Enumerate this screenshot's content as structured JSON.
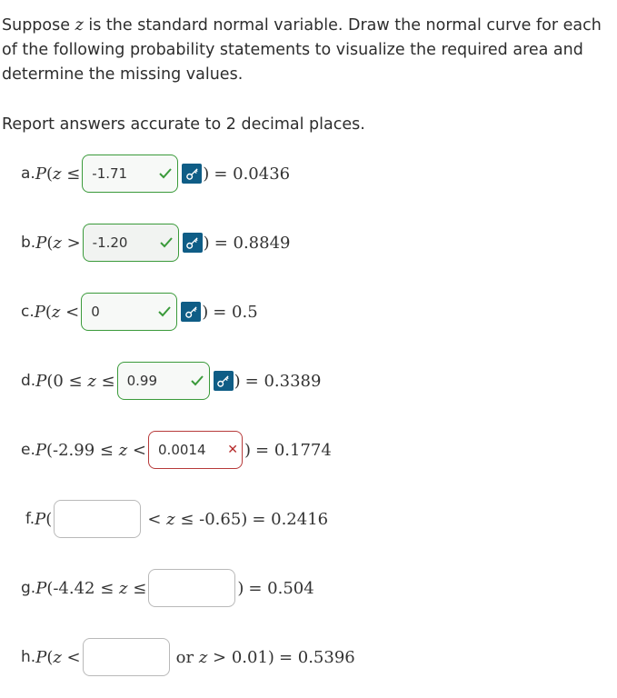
{
  "intro": {
    "p1_before": "Suppose ",
    "p1_var": "z",
    "p1_after": " is the standard normal variable. Draw the normal curve for each of the following probability statements to visualize the required area and determine the missing values.",
    "instruction": "Report answers accurate to 2 decimal places."
  },
  "rows": {
    "a": {
      "label": "a. ",
      "pre": "P(z ≤",
      "value": "-1.71",
      "status": "correct",
      "close": ")",
      "result": "= 0.0436"
    },
    "b": {
      "label": "b. ",
      "pre": "P(z >",
      "value": "-1.20",
      "status": "correct",
      "close": ")",
      "result": "= 0.8849"
    },
    "c": {
      "label": "c. ",
      "pre": "P(z <",
      "value": "0",
      "status": "correct",
      "close": ")",
      "result": "= 0.5"
    },
    "d": {
      "label": "d. ",
      "pre": "P(0 ≤ z ≤",
      "value": "0.99",
      "status": "correct",
      "close": ")",
      "result": "= 0.3389"
    },
    "e": {
      "label": "e. ",
      "pre": "P(-2.99 ≤ z <",
      "value": "0.0014",
      "status": "incorrect",
      "close": ")",
      "result": "= 0.1774"
    },
    "f": {
      "label": "f. ",
      "pre": "P(",
      "value": "",
      "status": "empty",
      "post": "< z ≤ -0.65)",
      "result": "= 0.2416"
    },
    "g": {
      "label": "g. ",
      "pre": "P(-4.42 ≤ z ≤",
      "value": "",
      "status": "empty",
      "close": ")",
      "result": "= 0.504"
    },
    "h": {
      "label": "h. ",
      "pre": "P(z <",
      "value": "",
      "status": "empty",
      "post": "or z > 0.01)",
      "result": "= 0.5396"
    }
  },
  "icons": {
    "check": "check-icon",
    "key": "key-icon",
    "x": "x-mark-icon"
  },
  "colors": {
    "correct": "#3a9a3a",
    "incorrect": "#b73a3a",
    "key_bg": "#0f5d86"
  }
}
